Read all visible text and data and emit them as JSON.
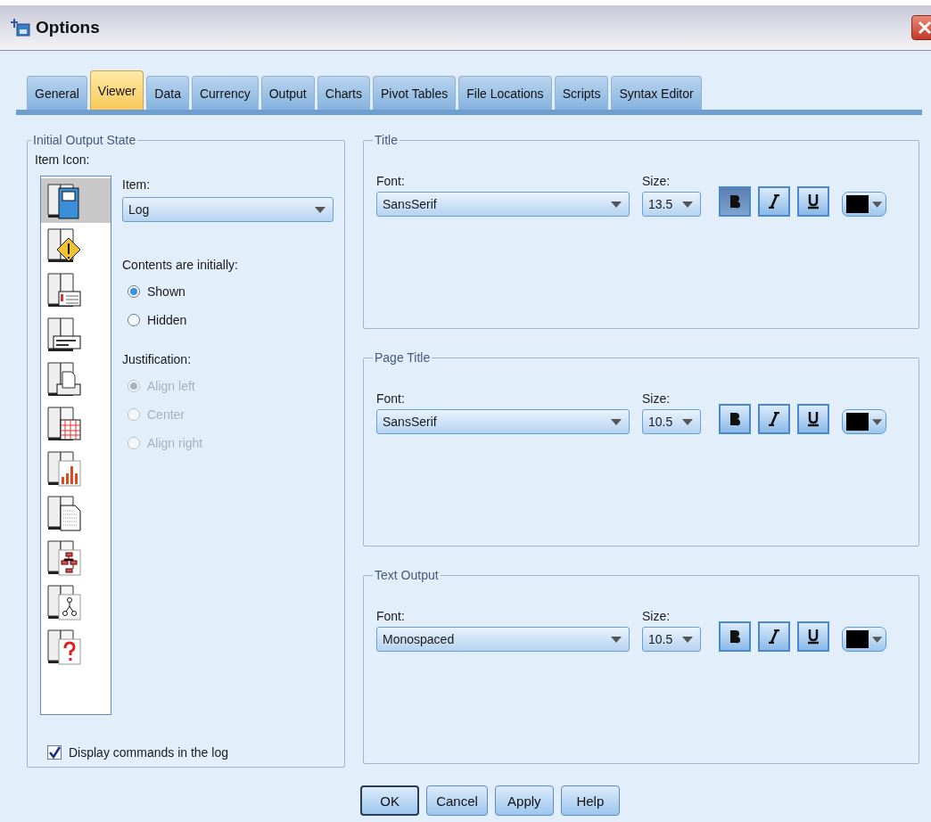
{
  "window": {
    "title": "Options"
  },
  "tabs": [
    {
      "label": "General",
      "selected": false
    },
    {
      "label": "Viewer",
      "selected": true
    },
    {
      "label": "Data",
      "selected": false
    },
    {
      "label": "Currency",
      "selected": false
    },
    {
      "label": "Output",
      "selected": false
    },
    {
      "label": "Charts",
      "selected": false
    },
    {
      "label": "Pivot Tables",
      "selected": false
    },
    {
      "label": "File Locations",
      "selected": false
    },
    {
      "label": "Scripts",
      "selected": false
    },
    {
      "label": "Syntax Editor",
      "selected": false
    }
  ],
  "initial_output_state": {
    "title": "Initial Output State",
    "item_icon_label": "Item Icon:",
    "item_icons": [
      {
        "kind": "log",
        "selected": true
      },
      {
        "kind": "warning",
        "selected": false
      },
      {
        "kind": "notes",
        "selected": false
      },
      {
        "kind": "title",
        "selected": false
      },
      {
        "kind": "page",
        "selected": false
      },
      {
        "kind": "table",
        "selected": false
      },
      {
        "kind": "chart",
        "selected": false
      },
      {
        "kind": "text",
        "selected": false
      },
      {
        "kind": "tree",
        "selected": false
      },
      {
        "kind": "model",
        "selected": false
      },
      {
        "kind": "unknown",
        "selected": false
      }
    ],
    "item_label": "Item:",
    "item_value": "Log",
    "contents_label": "Contents are initially:",
    "contents_options": [
      {
        "label": "Shown",
        "selected": true
      },
      {
        "label": "Hidden",
        "selected": false
      }
    ],
    "justification_label": "Justification:",
    "justification_disabled": true,
    "justification_options": [
      {
        "label": "Align left",
        "selected": true
      },
      {
        "label": "Center",
        "selected": false
      },
      {
        "label": "Align right",
        "selected": false
      }
    ],
    "display_commands": {
      "label": "Display commands in the log",
      "checked": true
    }
  },
  "font_groups": [
    {
      "title": "Title",
      "font_label": "Font:",
      "font": "SansSerif",
      "size_label": "Size:",
      "size": "13.5",
      "bold": true,
      "italic": false,
      "underline": false,
      "color": "#000000"
    },
    {
      "title": "Page Title",
      "font_label": "Font:",
      "font": "SansSerif",
      "size_label": "Size:",
      "size": "10.5",
      "bold": false,
      "italic": false,
      "underline": false,
      "color": "#000000"
    },
    {
      "title": "Text Output",
      "font_label": "Font:",
      "font": "Monospaced",
      "size_label": "Size:",
      "size": "10.5",
      "bold": false,
      "italic": false,
      "underline": false,
      "color": "#000000"
    }
  ],
  "buttons": [
    {
      "label": "OK",
      "default": true
    },
    {
      "label": "Cancel",
      "default": false
    },
    {
      "label": "Apply",
      "default": false
    },
    {
      "label": "Help",
      "default": false
    }
  ]
}
